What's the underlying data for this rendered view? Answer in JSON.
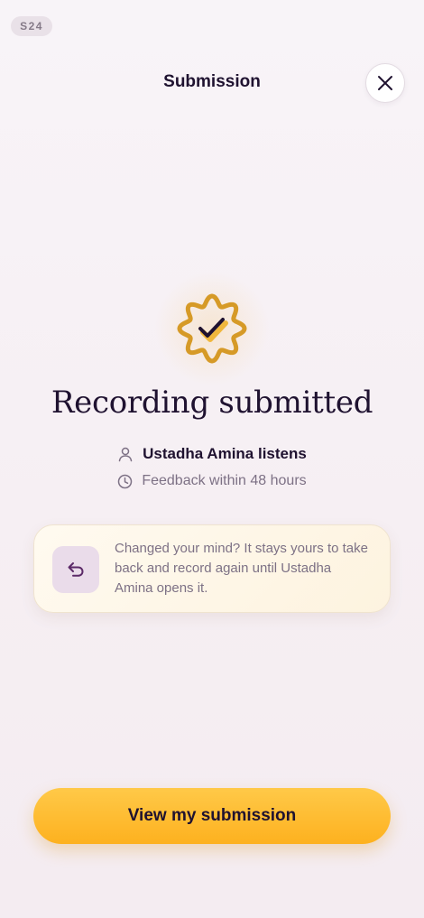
{
  "screen_tag": "S24",
  "header": {
    "title": "Submission"
  },
  "status": {
    "heading": "Recording submitted",
    "teacher_line": "Ustadha Amina listens",
    "feedback_line": "Feedback within 48 hours"
  },
  "info_card": {
    "text": "Changed your mind? It stays yours to take back and record again until Ustadha Amina opens it."
  },
  "cta": {
    "label": "View my submission"
  },
  "icons": {
    "close": "close-icon",
    "badge": "verified-badge-icon",
    "teacher": "person-icon",
    "feedback": "clock-icon",
    "undo": "undo-arrow-icon"
  },
  "colors": {
    "accent_gold": "#D69A27",
    "cta_yellow": "#FDB11F",
    "undo_tile": "#EADCEA",
    "undo_arrow": "#5C2A68",
    "text_dark": "#1F1230",
    "text_muted": "#7D7185"
  }
}
